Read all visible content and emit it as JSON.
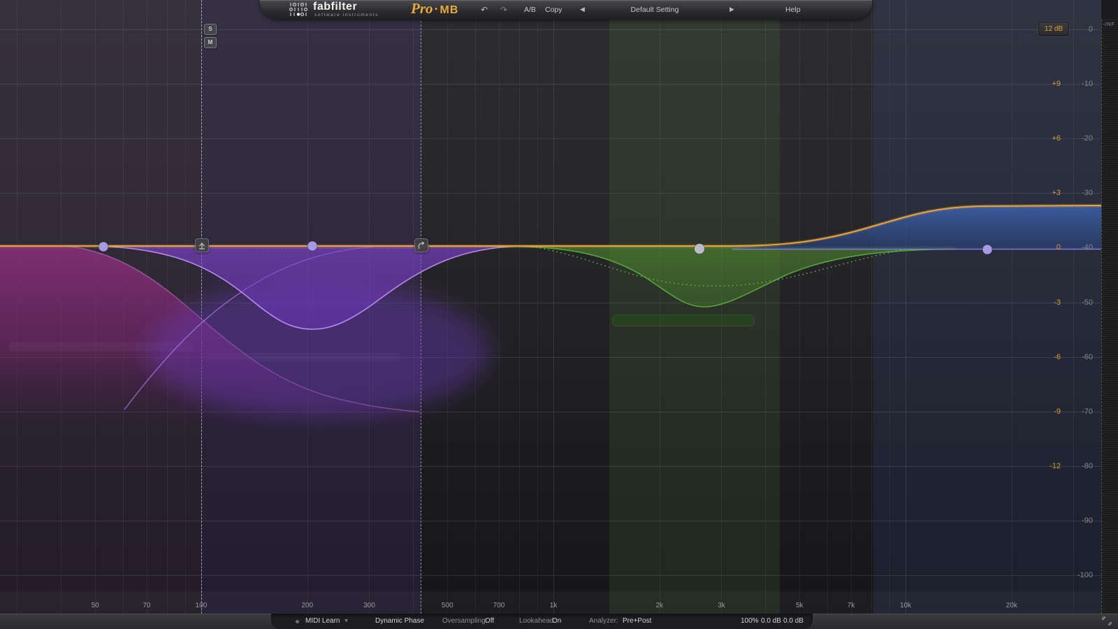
{
  "titlebar": {
    "logo_text": "fabfilter",
    "logo_subtext": "software instruments",
    "product_name": "Pro",
    "product_sep": "·",
    "product_suffix": "MB",
    "undo_icon": "↶",
    "redo_icon": "↷",
    "ab_label": "A/B",
    "copy_label": "Copy",
    "preset_prev_icon": "◀",
    "preset_name": "Default Setting",
    "preset_next_icon": "▶",
    "help_label": "Help"
  },
  "display": {
    "range_badge": "12 dB",
    "inf_label": "-INF",
    "solo_button": "S",
    "mute_button": "M",
    "gain_scale_labels": [
      "+9",
      "+6",
      "+3",
      "0",
      "-3",
      "-6",
      "-9",
      "-12"
    ],
    "level_scale_labels": [
      "0",
      "-10",
      "-20",
      "-30",
      "-40",
      "-50",
      "-60",
      "-70",
      "-80",
      "-90",
      "-100"
    ],
    "freq_ticks": [
      {
        "label": "50",
        "f": 50
      },
      {
        "label": "70",
        "f": 70
      },
      {
        "label": "100",
        "f": 100
      },
      {
        "label": "200",
        "f": 200
      },
      {
        "label": "300",
        "f": 300
      },
      {
        "label": "500",
        "f": 500
      },
      {
        "label": "700",
        "f": 700
      },
      {
        "label": "1k",
        "f": 1000
      },
      {
        "label": "2k",
        "f": 2000
      },
      {
        "label": "3k",
        "f": 3000
      },
      {
        "label": "5k",
        "f": 5000
      },
      {
        "label": "7k",
        "f": 7000
      },
      {
        "label": "10k",
        "f": 10000
      },
      {
        "label": "20k",
        "f": 20000
      }
    ]
  },
  "bands": [
    {
      "name": "low-purple",
      "color": "#8d2f7d",
      "dot_color": "#a79ae2"
    },
    {
      "name": "low-mid-purple",
      "color": "#8448d8",
      "dot_color": "#a79ae2"
    },
    {
      "name": "mid-green",
      "color": "#55a637",
      "dot_color": "#bcbcc4"
    },
    {
      "name": "high-blue",
      "color": "#3a5a9a",
      "dot_color": "#a79ae2"
    }
  ],
  "bottom_bar": {
    "midi_learn_label": "MIDI Learn",
    "midi_caret_icon": "▼",
    "dynamic_phase_label": "Dynamic Phase",
    "oversampling_label": "Oversampling:",
    "oversampling_value": "Off",
    "lookahead_label": "Lookahead:",
    "lookahead_value": "On",
    "analyzer_label": "Analyzer:",
    "analyzer_value": "Pre+Post",
    "mix_value": "100%",
    "in_gain_value": "0.0 dB",
    "out_gain_value": "0.0 dB"
  },
  "colors": {
    "accent_orange": "#e7a43e",
    "violet_zero_line": "#8d7ce8",
    "crossover_dash": "#eeeef4"
  }
}
